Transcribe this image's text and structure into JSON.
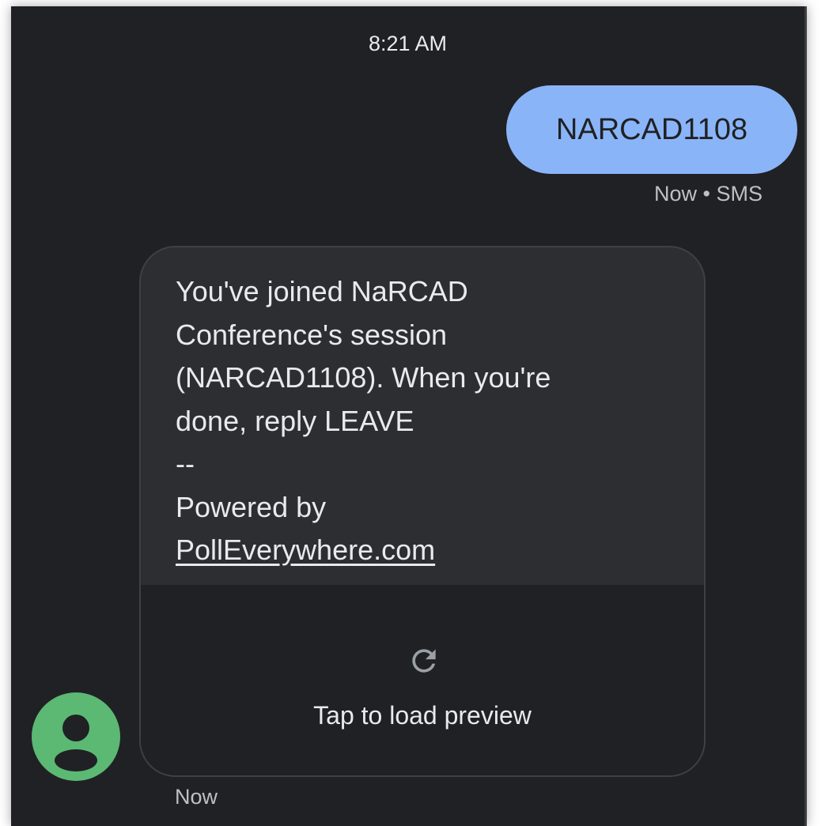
{
  "thread": {
    "timestamp": "8:21 AM"
  },
  "outgoing": {
    "text": "NARCAD1108",
    "meta": "Now • SMS",
    "bubble_color": "#8ab4f8"
  },
  "incoming": {
    "lines": [
      "You've joined NaRCAD",
      "Conference's session",
      "(NARCAD1108). When you're",
      "done, reply LEAVE",
      "--",
      "Powered by"
    ],
    "link": "PollEverywhere.com",
    "preview_label": "Tap to load preview",
    "preview_icon": "refresh-icon",
    "meta": "Now",
    "avatar_icon": "person-icon",
    "avatar_color": "#5bb974"
  },
  "colors": {
    "background": "#202124",
    "text": "#e8eaed",
    "meta_text": "#bdc1c6"
  }
}
